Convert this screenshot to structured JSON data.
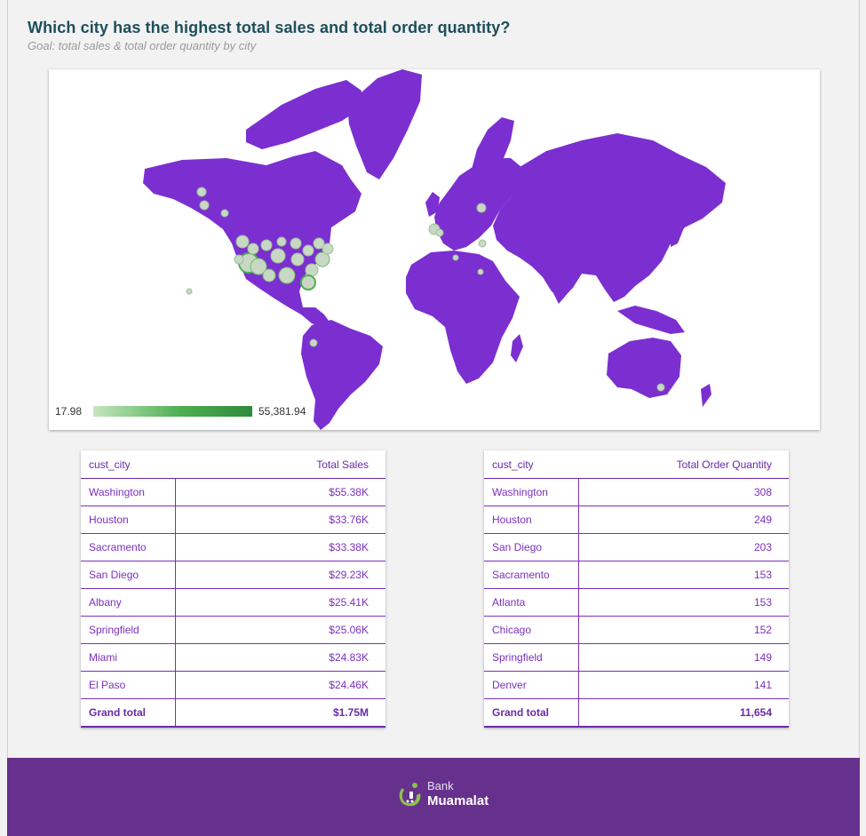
{
  "header": {
    "title": "Which city has the highest total sales and total order quantity?",
    "subtitle": "Goal: total sales & total order quantity by city"
  },
  "map": {
    "land_color": "#7b2fd0",
    "bubble_color": "#c8d8c4",
    "bubble_accent": "#4caf50",
    "legend_min": "17.98",
    "legend_max": "55,381.94"
  },
  "sales_table": {
    "columns": [
      "cust_city",
      "Total Sales"
    ],
    "rows": [
      [
        "Washington",
        "$55.38K"
      ],
      [
        "Houston",
        "$33.76K"
      ],
      [
        "Sacramento",
        "$33.38K"
      ],
      [
        "San Diego",
        "$29.23K"
      ],
      [
        "Albany",
        "$25.41K"
      ],
      [
        "Springfield",
        "$25.06K"
      ],
      [
        "Miami",
        "$24.83K"
      ],
      [
        "El Paso",
        "$24.46K"
      ]
    ],
    "total": [
      "Grand total",
      "$1.75M"
    ]
  },
  "qty_table": {
    "columns": [
      "cust_city",
      "Total Order Quantity"
    ],
    "rows": [
      [
        "Washington",
        "308"
      ],
      [
        "Houston",
        "249"
      ],
      [
        "San Diego",
        "203"
      ],
      [
        "Sacramento",
        "153"
      ],
      [
        "Atlanta",
        "153"
      ],
      [
        "Chicago",
        "152"
      ],
      [
        "Springfield",
        "149"
      ],
      [
        "Denver",
        "141"
      ]
    ],
    "total": [
      "Grand total",
      "11,654"
    ]
  },
  "footer": {
    "brand_line1": "Bank",
    "brand_line2": "Muamalat",
    "background": "#66308d"
  }
}
